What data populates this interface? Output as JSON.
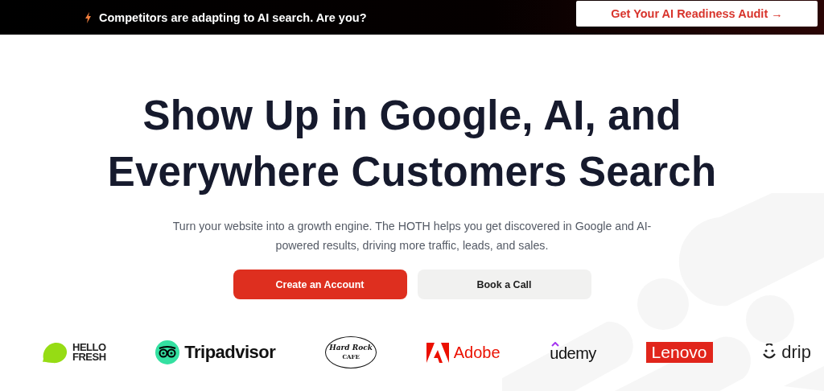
{
  "announcement_bar": {
    "message": "Competitors are adapting to AI search. Are you?",
    "cta": "Get Your AI Readiness Audit →"
  },
  "hero": {
    "headline_lines": [
      "Show Up in Google, AI, and",
      "Everywhere Customers Search"
    ],
    "subtitle": "Turn your website into a growth engine. The HOTH helps you get discovered in Google and AI-powered results, driving more traffic, leads, and sales.",
    "buttons": [
      {
        "label": "Create an Account",
        "kind": "primary"
      },
      {
        "label": "Book a Call",
        "kind": "secondary"
      }
    ]
  },
  "logos": [
    {
      "kind": "hellofresh",
      "lines": [
        "HELLO",
        "FRESH"
      ]
    },
    {
      "kind": "tripadvisor",
      "lines": [
        "Tripadvisor"
      ]
    },
    {
      "kind": "hardrock",
      "lines": [
        "Hard Rock",
        "CAFE"
      ]
    },
    {
      "kind": "adobe",
      "lines": [
        "Adobe"
      ]
    },
    {
      "kind": "udemy",
      "lines": [
        "udemy"
      ]
    },
    {
      "kind": "lenovo",
      "lines": [
        "Lenovo"
      ]
    },
    {
      "kind": "drip",
      "lines": [
        "drip"
      ]
    }
  ]
}
